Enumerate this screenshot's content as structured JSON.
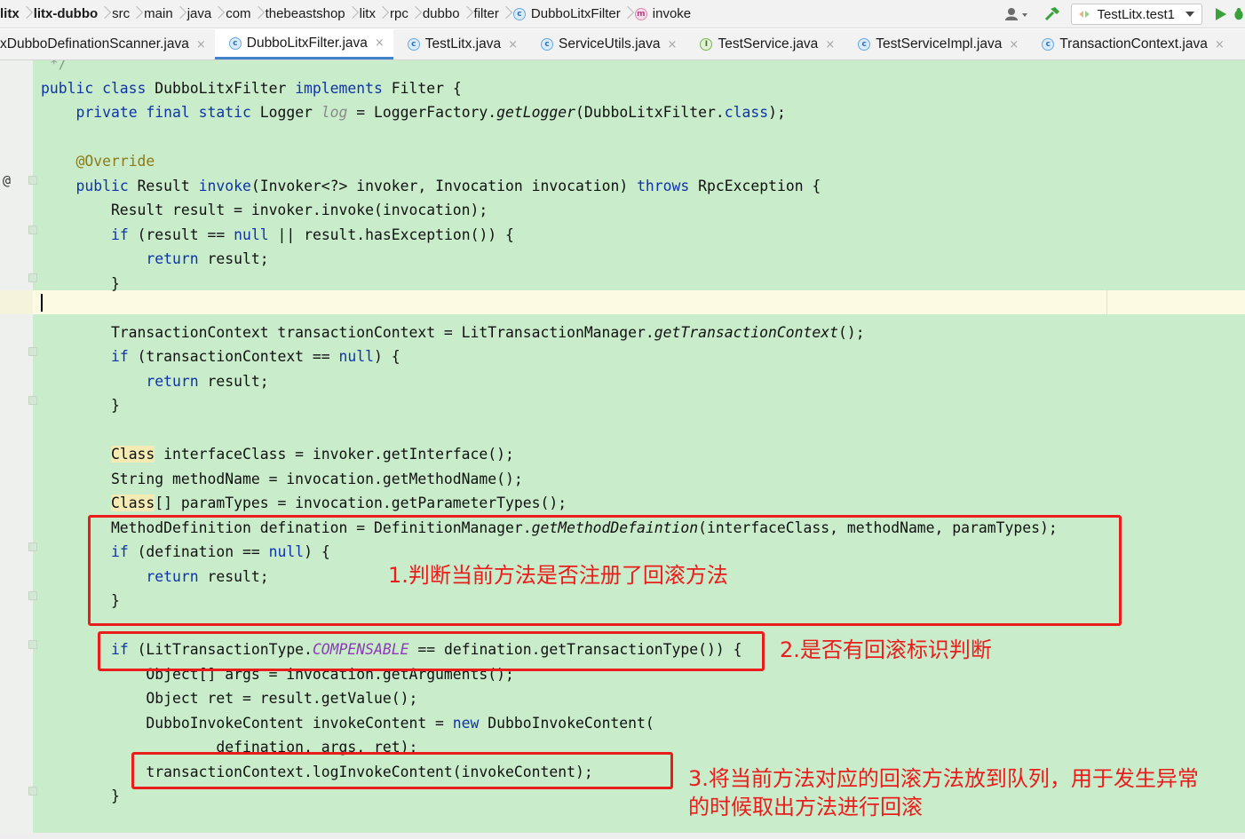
{
  "breadcrumb": [
    {
      "label": "litx",
      "bold": true
    },
    {
      "label": "litx-dubbo",
      "bold": true
    },
    {
      "label": "src"
    },
    {
      "label": "main"
    },
    {
      "label": "java"
    },
    {
      "label": "com"
    },
    {
      "label": "thebeastshop"
    },
    {
      "label": "litx"
    },
    {
      "label": "rpc"
    },
    {
      "label": "dubbo"
    },
    {
      "label": "filter"
    },
    {
      "label": "DubboLitxFilter",
      "icon": "class-icon"
    },
    {
      "label": "invoke",
      "icon": "method-icon"
    }
  ],
  "toolbar": {
    "run_config_label": "TestLitx.test1",
    "colors": {
      "run": "#3aa13a",
      "debug": "#3aa13a",
      "build": "#3aa13a"
    }
  },
  "tabs": [
    {
      "label": "xDubboDefinationScanner.java",
      "icon": "class-icon",
      "active": false
    },
    {
      "label": "DubboLitxFilter.java",
      "icon": "class-icon",
      "active": true
    },
    {
      "label": "TestLitx.java",
      "icon": "class-icon",
      "active": false
    },
    {
      "label": "ServiceUtils.java",
      "icon": "class-icon",
      "active": false
    },
    {
      "label": "TestService.java",
      "icon": "interface-icon",
      "active": false
    },
    {
      "label": "TestServiceImpl.java",
      "icon": "class-icon",
      "active": false
    },
    {
      "label": "TransactionContext.java",
      "icon": "class-icon",
      "active": false
    }
  ],
  "code": [
    [
      [
        "cmt",
        " */"
      ]
    ],
    [
      [
        "kw",
        "public class "
      ],
      [
        "",
        "DubboLitxFilter "
      ],
      [
        "kw",
        "implements "
      ],
      [
        "",
        "Filter {"
      ]
    ],
    [
      [
        "",
        "    "
      ],
      [
        "kw",
        "private final static "
      ],
      [
        "",
        "Logger "
      ],
      [
        "fld-it",
        "log"
      ],
      [
        "",
        " = LoggerFactory."
      ],
      [
        "it",
        "getLogger"
      ],
      [
        "",
        "(DubboLitxFilter."
      ],
      [
        "kw",
        "class"
      ],
      [
        "",
        ");"
      ]
    ],
    [
      [
        "",
        ""
      ]
    ],
    [
      [
        "",
        "    "
      ],
      [
        "ann",
        "@Override"
      ]
    ],
    [
      [
        "",
        "    "
      ],
      [
        "kw",
        "public "
      ],
      [
        "",
        "Result "
      ],
      [
        "kw",
        "invoke"
      ],
      [
        "",
        "(Invoker<?> invoker, Invocation invocation) "
      ],
      [
        "kw",
        "throws "
      ],
      [
        "",
        "RpcException {"
      ]
    ],
    [
      [
        "",
        "        Result result = invoker.invoke(invocation);"
      ]
    ],
    [
      [
        "",
        "        "
      ],
      [
        "kw",
        "if "
      ],
      [
        "",
        "(result == "
      ],
      [
        "kw",
        "null"
      ],
      [
        "",
        " || result.hasException()) {"
      ]
    ],
    [
      [
        "",
        "            "
      ],
      [
        "kw",
        "return "
      ],
      [
        "",
        "result;"
      ]
    ],
    [
      [
        "",
        "        }"
      ]
    ],
    [
      [
        "",
        ""
      ]
    ],
    [
      [
        "",
        "        TransactionContext transactionContext = LitTransactionManager."
      ],
      [
        "it",
        "getTransactionContext"
      ],
      [
        "",
        "();"
      ]
    ],
    [
      [
        "",
        "        "
      ],
      [
        "kw",
        "if "
      ],
      [
        "",
        "(transactionContext == "
      ],
      [
        "kw",
        "null"
      ],
      [
        "",
        ") {"
      ]
    ],
    [
      [
        "",
        "            "
      ],
      [
        "kw",
        "return "
      ],
      [
        "",
        "result;"
      ]
    ],
    [
      [
        "",
        "        }"
      ]
    ],
    [
      [
        "",
        ""
      ]
    ],
    [
      [
        "",
        "        "
      ],
      [
        "cls-hl",
        "Class"
      ],
      [
        "",
        " interfaceClass = invoker.getInterface();"
      ]
    ],
    [
      [
        "",
        "        String methodName = invocation.getMethodName();"
      ]
    ],
    [
      [
        "",
        "        "
      ],
      [
        "cls-hl",
        "Class"
      ],
      [
        "",
        "[] paramTypes = invocation.getParameterTypes();"
      ]
    ],
    [
      [
        "",
        "        MethodDefinition defination = DefinitionManager."
      ],
      [
        "it",
        "getMethodDefaintion"
      ],
      [
        "",
        "(interfaceClass, methodName, paramTypes);"
      ]
    ],
    [
      [
        "",
        "        "
      ],
      [
        "kw",
        "if "
      ],
      [
        "",
        "(defination == "
      ],
      [
        "kw",
        "null"
      ],
      [
        "",
        ") {"
      ]
    ],
    [
      [
        "",
        "            "
      ],
      [
        "kw",
        "return "
      ],
      [
        "",
        "result;"
      ]
    ],
    [
      [
        "",
        "        }"
      ]
    ],
    [
      [
        "",
        ""
      ]
    ],
    [
      [
        "",
        "        "
      ],
      [
        "kw",
        "if "
      ],
      [
        "",
        "(LitTransactionType."
      ],
      [
        "const",
        "COMPENSABLE"
      ],
      [
        "",
        " == defination.getTransactionType()) {"
      ]
    ],
    [
      [
        "",
        "            Object[] args = invocation.getArguments();"
      ]
    ],
    [
      [
        "",
        "            Object ret = result.getValue();"
      ]
    ],
    [
      [
        "",
        "            DubboInvokeContent invokeContent = "
      ],
      [
        "kw",
        "new "
      ],
      [
        "",
        "DubboInvokeContent("
      ]
    ],
    [
      [
        "",
        "                    defination, args, ret);"
      ]
    ],
    [
      [
        "",
        "            transactionContext.logInvokeContent(invokeContent);"
      ]
    ],
    [
      [
        "",
        "        }"
      ]
    ]
  ],
  "annotations": {
    "note1": "1.判断当前方法是否注册了回滚方法",
    "note2": "2.是否有回滚标识判断",
    "note3_line1": "3.将当前方法对应的回滚方法放到队列，用于发生异常",
    "note3_line2": "的时候取出方法进行回滚",
    "box_color": "#ea1c1c"
  },
  "gutter_symbol": "@"
}
